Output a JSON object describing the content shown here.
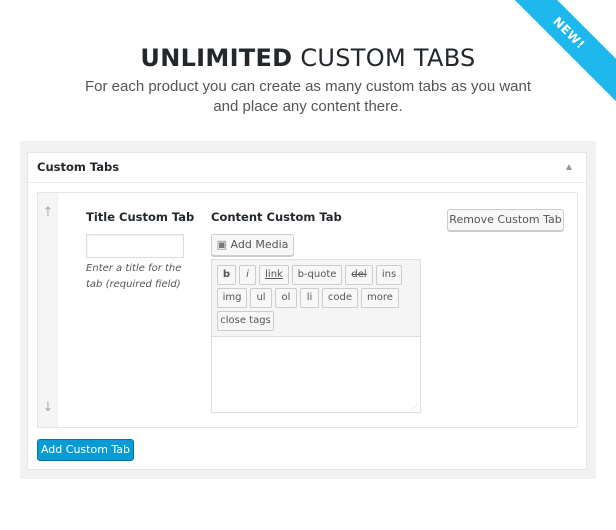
{
  "ribbon": {
    "label": "NEW!",
    "color": "#1eb8ef"
  },
  "hero": {
    "title_bold": "UNLIMITED",
    "title_rest": "CUSTOM TABS",
    "line1": "For each product you can create as many custom tabs as you want",
    "line2": "and place any content there."
  },
  "panel": {
    "title": "Custom Tabs",
    "toggle_icon": "triangle-up"
  },
  "row": {
    "title_label": "Title Custom Tab",
    "title_value": "",
    "title_hint": "Enter a title for the tab (required field)",
    "content_label": "Content Custom Tab",
    "add_media": "Add Media",
    "remove": "Remove Custom Tab",
    "quicktags": [
      "b",
      "i",
      "link",
      "b-quote",
      "del",
      "ins",
      "img",
      "ul",
      "ol",
      "li",
      "code",
      "more",
      "close tags"
    ],
    "content_value": ""
  },
  "add_button": "Add Custom Tab",
  "accent": "#0a9bd5"
}
